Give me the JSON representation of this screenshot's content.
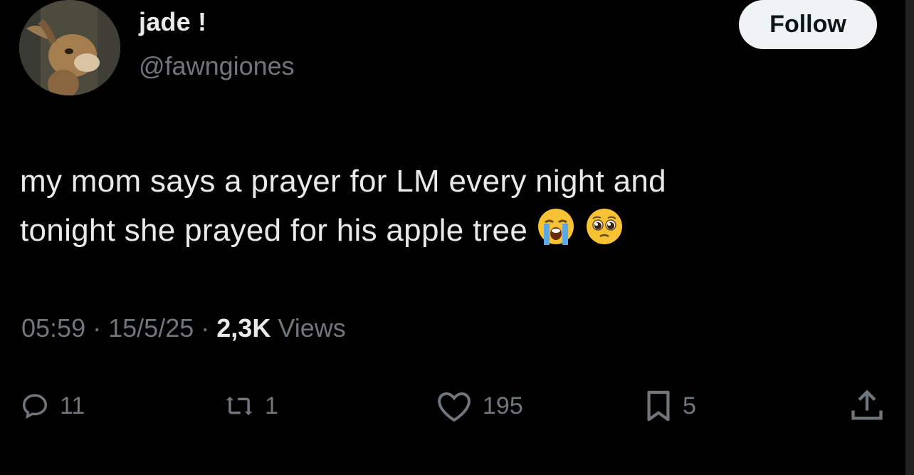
{
  "user": {
    "display_name": "jade !",
    "handle": "@fawngiones"
  },
  "follow_label": "Follow",
  "tweet": {
    "line1": "my mom says a prayer for LM every night and",
    "line2": "tonight she prayed for his apple tree",
    "emojis": [
      "loudly-crying-face-emoji",
      "pleading-face-emoji"
    ]
  },
  "meta": {
    "time": "05:59",
    "sep1": "·",
    "date": "15/5/25",
    "sep2": "·",
    "views_count": "2,3K",
    "views_label": "Views"
  },
  "actions": {
    "replies": "11",
    "reposts": "1",
    "likes": "195",
    "bookmarks": "5"
  },
  "colors": {
    "background": "#000000",
    "text_primary": "#e7e9ea",
    "text_secondary": "#71767b",
    "follow_bg": "#eff3f4"
  }
}
